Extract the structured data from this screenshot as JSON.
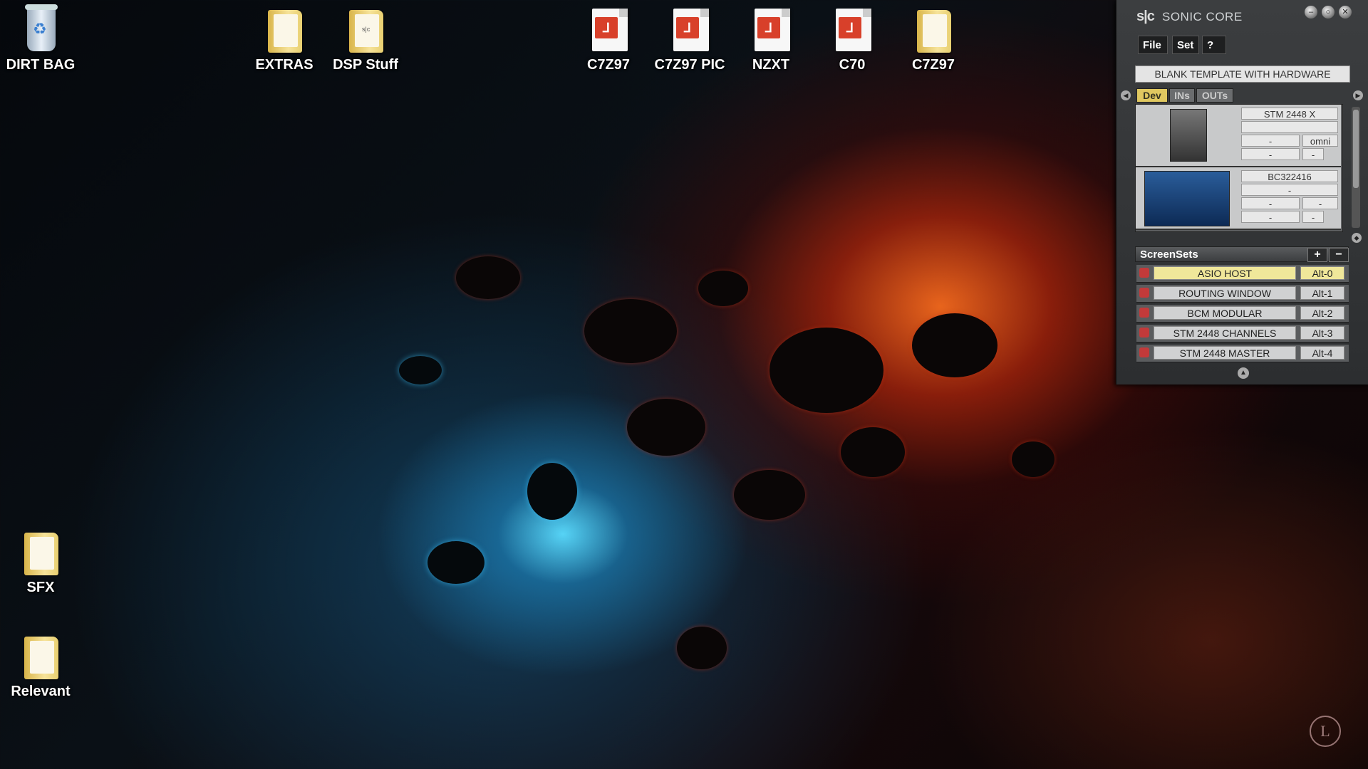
{
  "desktop_icons": [
    {
      "label": "DIRT BAG",
      "icon": "recycle-bin-icon"
    },
    {
      "label": "EXTRAS",
      "icon": "folder-icon"
    },
    {
      "label": "DSP Stuff",
      "icon": "folder-icon",
      "tag": "s|c"
    },
    {
      "label": "C7Z97",
      "icon": "pdf-icon"
    },
    {
      "label": "C7Z97 PIC",
      "icon": "pdf-icon"
    },
    {
      "label": "NZXT",
      "icon": "pdf-icon"
    },
    {
      "label": "C70",
      "icon": "pdf-icon"
    },
    {
      "label": "C7Z97",
      "icon": "folder-icon"
    },
    {
      "label": "SFX",
      "icon": "folder-icon"
    },
    {
      "label": "Relevant",
      "icon": "folder-icon"
    }
  ],
  "sonic_core": {
    "logo": "s|c",
    "title": "SONIC CORE",
    "menu": {
      "file": "File",
      "set": "Set",
      "help": "?"
    },
    "preset": "BLANK TEMPLATE WITH HARDWARE",
    "tabs": [
      "Dev",
      "INs",
      "OUTs"
    ],
    "devices": [
      {
        "name": "STM 2448 X",
        "field2": "",
        "field3a": "-",
        "field3b": "omni",
        "field4a": "-",
        "field4b": "-"
      },
      {
        "name": "BC322416",
        "field2": "-",
        "field3a": "-",
        "field3b": "-",
        "field4a": "-",
        "field4b": "-"
      }
    ],
    "screensets_title": "ScreenSets",
    "add_label": "+",
    "remove_label": "−",
    "screensets": [
      {
        "name": "ASIO HOST",
        "key": "Alt-0",
        "active": true
      },
      {
        "name": "ROUTING WINDOW",
        "key": "Alt-1",
        "active": false
      },
      {
        "name": "BCM MODULAR",
        "key": "Alt-2",
        "active": false
      },
      {
        "name": "STM 2448 CHANNELS",
        "key": "Alt-3",
        "active": false
      },
      {
        "name": "STM 2448 MASTER",
        "key": "Alt-4",
        "active": false
      }
    ],
    "colors": {
      "active_tab": "#e0c860",
      "active_row": "#f0e79a",
      "lock": "#c23a3a"
    }
  },
  "watermark": "L"
}
